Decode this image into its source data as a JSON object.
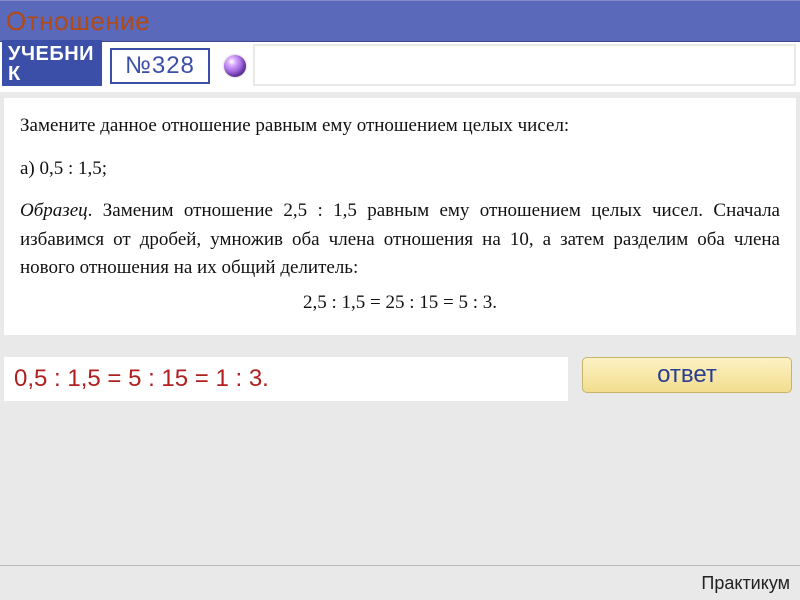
{
  "titlebar": {
    "title": "Отношение"
  },
  "subheader": {
    "badge": "УЧЕБНИК",
    "number": "№328"
  },
  "problem": {
    "prompt": "Замените данное отношение равным ему отношением целых чисел:",
    "part_a": "а) 0,5 : 1,5;",
    "sample_label": "Образец",
    "sample_text": ". Заменим отношение 2,5 : 1,5 равным ему отношением целых чисел. Сначала избавимся от дробей, умножив оба члена отношения на 10, а затем разделим оба члена нового отношения на их общий делитель:",
    "equation": "2,5 : 1,5 = 25 : 15 = 5 : 3."
  },
  "answer": {
    "solution": "0,5 : 1,5 = 5 : 15 = 1 : 3.",
    "button_label": "ответ"
  },
  "footer": {
    "text": "Практикум"
  }
}
